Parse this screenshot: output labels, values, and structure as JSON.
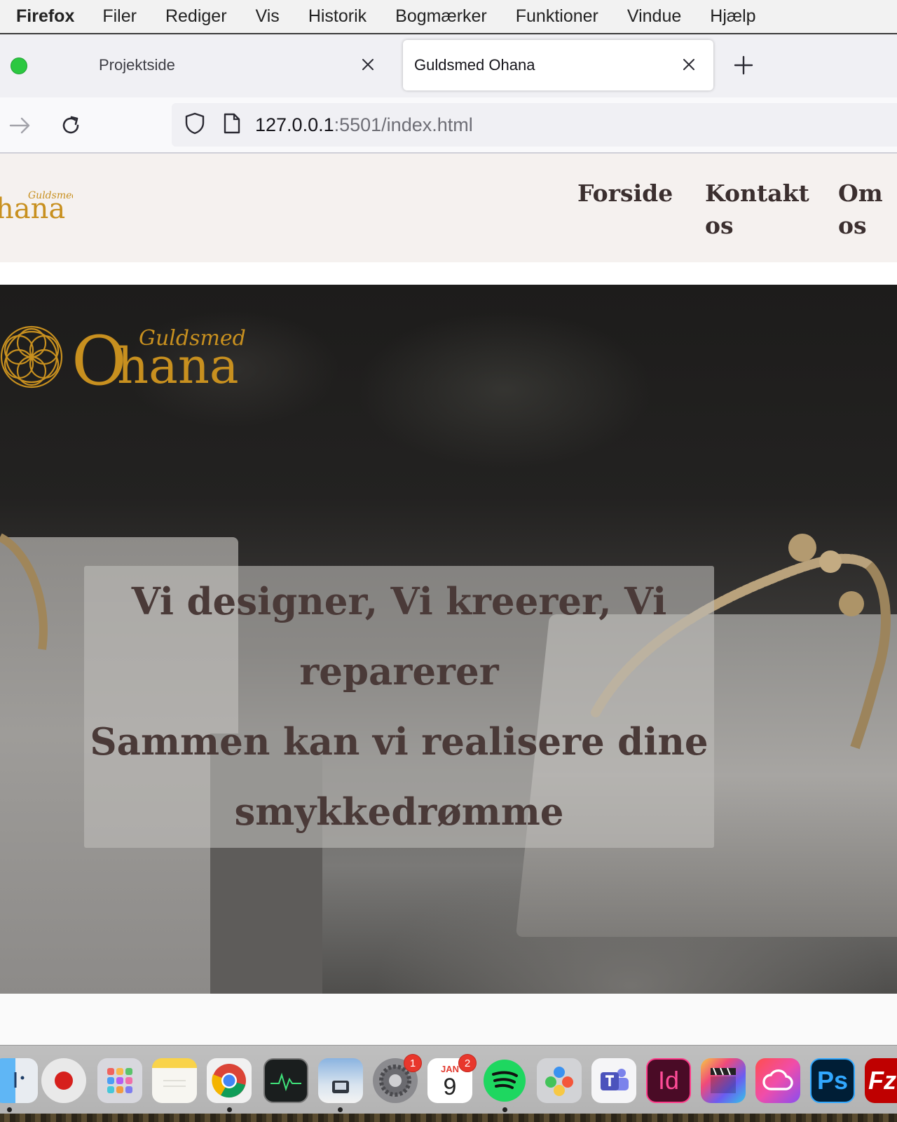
{
  "menubar": {
    "app_name": "Firefox",
    "items": [
      "Filer",
      "Rediger",
      "Vis",
      "Historik",
      "Bogmærker",
      "Funktioner",
      "Vindue",
      "Hjælp"
    ]
  },
  "tabs": [
    {
      "label": "Projektside",
      "active": false
    },
    {
      "label": "Guldsmed Ohana",
      "active": true
    }
  ],
  "navbar": {
    "url_host": "127.0.0.1",
    "url_rest": ":5501/index.html"
  },
  "site": {
    "logo_text": "Ohana",
    "logo_script": "Guldsmed",
    "nav": [
      {
        "line1": "Forside",
        "line2": ""
      },
      {
        "line1": "Kontakt",
        "line2": "os"
      },
      {
        "line1": "Om",
        "line2": "os"
      }
    ],
    "hero_lines": [
      "Vi designer, Vi kreerer, Vi",
      "reparerer",
      "Sammen kan vi realisere dine",
      "smykkedrømme"
    ]
  },
  "dock": {
    "calendar_month": "JAN",
    "calendar_day": "9",
    "badges": {
      "system_settings": "1",
      "calendar": "2"
    },
    "indesign_label": "Id",
    "photoshop_label": "Ps",
    "filezilla_label": "Fz"
  },
  "colors": {
    "gold": "#c8901f",
    "nav_text": "#3b2f2f",
    "hero_text": "#4a3a38",
    "header_bg": "#f5f1ef"
  }
}
